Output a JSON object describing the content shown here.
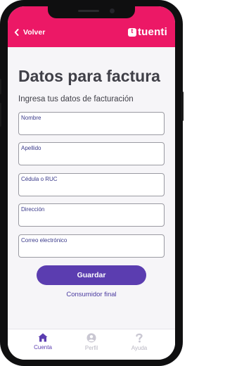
{
  "header": {
    "back_label": "Volver",
    "brand_name": "tuenti",
    "brand_mark": "t"
  },
  "page": {
    "title": "Datos para factura",
    "subtitle": "Ingresa tus datos de facturación"
  },
  "form": {
    "fields": [
      {
        "label": "Nombre",
        "value": ""
      },
      {
        "label": "Apellido",
        "value": ""
      },
      {
        "label": "Cédula o RUC",
        "value": ""
      },
      {
        "label": "Dirección",
        "value": ""
      },
      {
        "label": "Correo electrónico",
        "value": ""
      }
    ],
    "save_label": "Guardar",
    "final_consumer_label": "Consumidor final"
  },
  "nav": {
    "items": [
      {
        "label": "Cuenta",
        "icon": "home-icon",
        "active": true
      },
      {
        "label": "Perfil",
        "icon": "user-icon",
        "active": false
      },
      {
        "label": "Ayuda",
        "icon": "help-icon",
        "active": false
      }
    ]
  },
  "colors": {
    "brand": "#ec1866",
    "accent": "#5b3db0",
    "background": "#f6f5f8"
  }
}
